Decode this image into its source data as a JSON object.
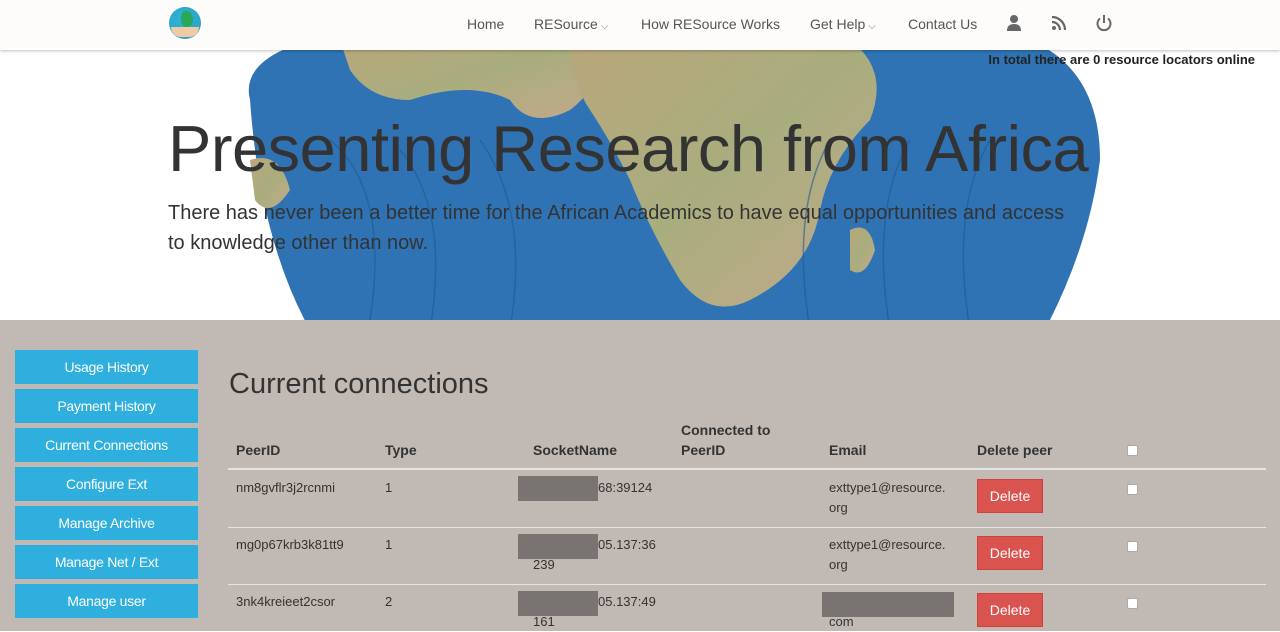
{
  "navbar": {
    "logo_alt": "RESource logo",
    "items": [
      {
        "label": "Home",
        "has_dropdown": false
      },
      {
        "label": "RESource",
        "has_dropdown": true
      },
      {
        "label": "How RESource Works",
        "has_dropdown": false
      },
      {
        "label": "Get Help",
        "has_dropdown": true
      },
      {
        "label": "Contact Us",
        "has_dropdown": false
      }
    ],
    "icons": [
      "user-icon",
      "rss-icon",
      "power-icon"
    ],
    "chevron": "⌄"
  },
  "hero": {
    "online_status": "In total there are 0 resource locators online",
    "title": "Presenting Research from Africa",
    "subtitle": "There has never been a better time for the African Academics to have equal opportunities and access to knowledge other than now."
  },
  "sidebar": {
    "items": [
      {
        "label": "Usage History"
      },
      {
        "label": "Payment History"
      },
      {
        "label": "Current Connections"
      },
      {
        "label": "Configure Ext"
      },
      {
        "label": "Manage Archive"
      },
      {
        "label": "Manage Net / Ext"
      },
      {
        "label": "Manage user"
      }
    ]
  },
  "main": {
    "title": "Current connections",
    "table": {
      "headers": {
        "peer_id": "PeerID",
        "type": "Type",
        "socket_name": "SocketName",
        "connected_to_line1": "Connected to",
        "connected_to_line2": "PeerID",
        "email": "Email",
        "delete_peer": "Delete peer"
      },
      "rows": [
        {
          "peer_id": "nm8gvflr3j2rcnmi",
          "type": "1",
          "socket_line1": "68:39124",
          "socket_line2": "",
          "connected_to": "",
          "email_line1": "exttype1@resource.",
          "email_line2": "org",
          "delete_label": "Delete"
        },
        {
          "peer_id": "mg0p67krb3k81tt9",
          "type": "1",
          "socket_line1": "05.137:36",
          "socket_line2": "239",
          "connected_to": "",
          "email_line1": "exttype1@resource.",
          "email_line2": "org",
          "delete_label": "Delete"
        },
        {
          "peer_id": "3nk4kreieet2csor",
          "type": "2",
          "socket_line1": "05.137:49",
          "socket_line2": "161",
          "connected_to": "",
          "email_line1": "",
          "email_line2": "com",
          "delete_label": "Delete"
        }
      ]
    }
  },
  "colors": {
    "sidebar_button": "#2eafdd",
    "delete_button": "#d9534f",
    "content_bg": "#c1b9b3",
    "redaction": "#797371"
  }
}
